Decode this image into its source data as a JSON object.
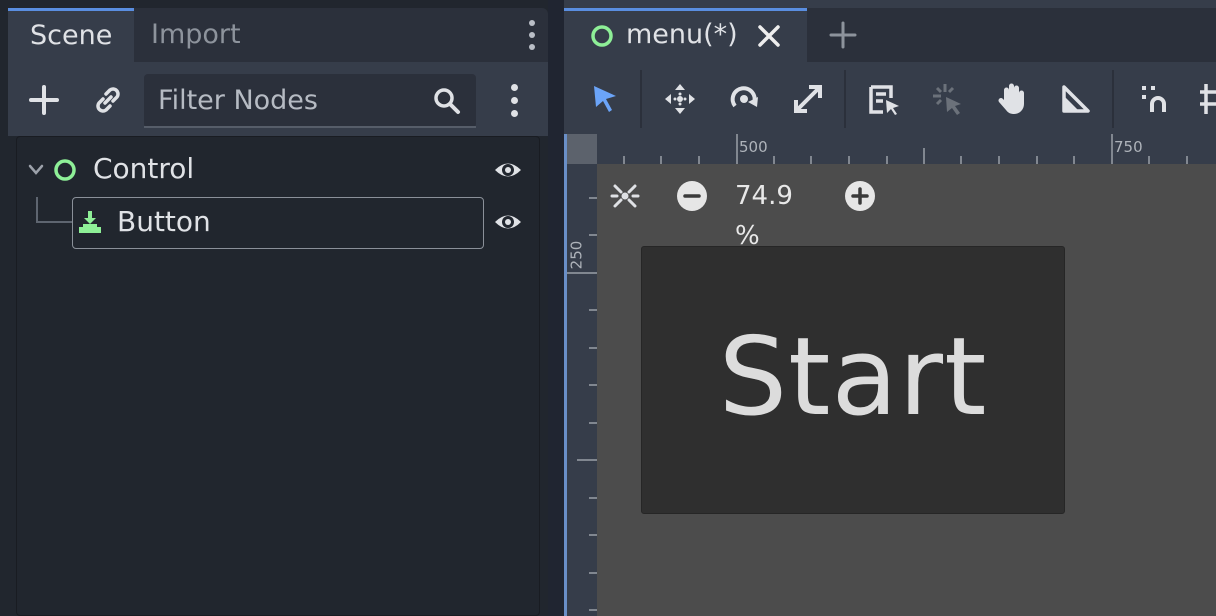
{
  "scene_dock": {
    "tabs": [
      {
        "label": "Scene",
        "active": true
      },
      {
        "label": "Import",
        "active": false
      }
    ],
    "toolbar": {
      "add_icon": "plus-icon",
      "link_icon": "link-icon",
      "filter_placeholder": "Filter Nodes",
      "filter_value": "",
      "search_icon": "search-icon",
      "menu_icon": "kebab-menu-icon"
    },
    "tree": [
      {
        "label": "Control",
        "icon": "control-node-icon",
        "expanded": true,
        "visible": true
      },
      {
        "label": "Button",
        "icon": "button-node-icon",
        "selected": true,
        "visible": true
      }
    ]
  },
  "editor": {
    "tabs": [
      {
        "label": "menu(*)",
        "active": true,
        "close_icon": "close-icon"
      }
    ],
    "add_tab_icon": "plus-icon",
    "tools": [
      "select-icon",
      "move-icon",
      "rotate-icon",
      "scale-icon",
      "list-select-icon",
      "pivot-icon",
      "pan-icon",
      "ruler-icon",
      "snap-icon",
      "grid-icon"
    ],
    "rulers": {
      "top": [
        "500",
        "750"
      ],
      "left": [
        "250"
      ]
    },
    "zoom": {
      "value": "74.9 %",
      "reset_icon": "zoom-reset-icon",
      "minus_icon": "zoom-out-icon",
      "plus_icon": "zoom-in-icon"
    },
    "canvas_button": {
      "label": "Start"
    }
  },
  "colors": {
    "accent": "#5a8ee0",
    "node_green": "#8eef97",
    "panel": "#363d4a",
    "base": "#21262e",
    "viewport": "#4c4c4c"
  }
}
